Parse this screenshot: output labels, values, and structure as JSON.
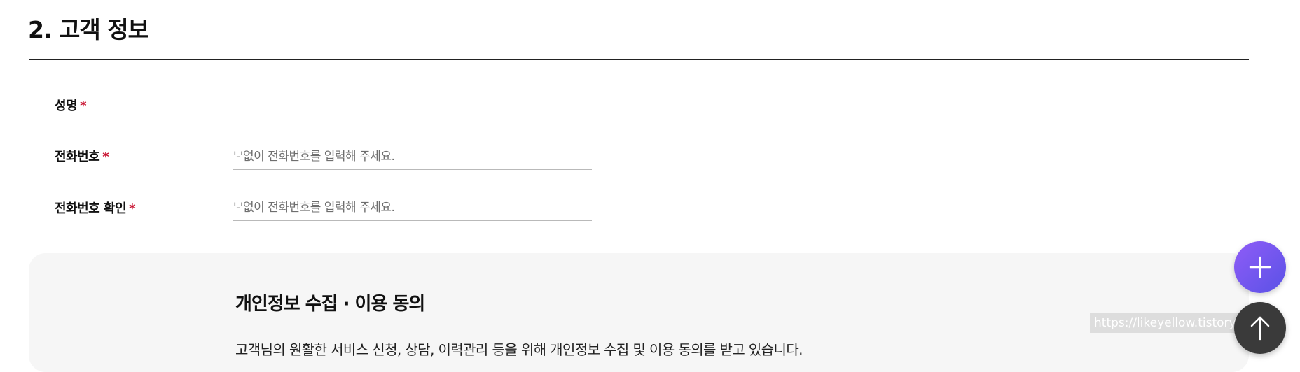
{
  "section": {
    "title": "2. 고객 정보"
  },
  "form": {
    "required_mark": "*",
    "fields": [
      {
        "label": "성명",
        "value": "",
        "placeholder": ""
      },
      {
        "label": "전화번호",
        "value": "",
        "placeholder": "'-'없이 전화번호를 입력해 주세요."
      },
      {
        "label": "전화번호 확인",
        "value": "",
        "placeholder": "'-'없이 전화번호를 입력해 주세요."
      }
    ]
  },
  "consent": {
    "title": "개인정보 수집 · 이용 동의",
    "description": "고객님의 원활한 서비스 신청, 상담, 이력관리 등을 위해 개인정보 수집 및 이용 동의를 받고 있습니다."
  },
  "watermark": {
    "text": "https://likeyellow.tistory.com"
  },
  "floating_buttons": {
    "add_icon": "plus-icon",
    "top_icon": "arrow-up-icon",
    "add_color": "#7b57f0",
    "top_color": "#3a3a3a"
  },
  "colors": {
    "required": "#c8102e",
    "panel_bg": "#f6f6f6"
  }
}
